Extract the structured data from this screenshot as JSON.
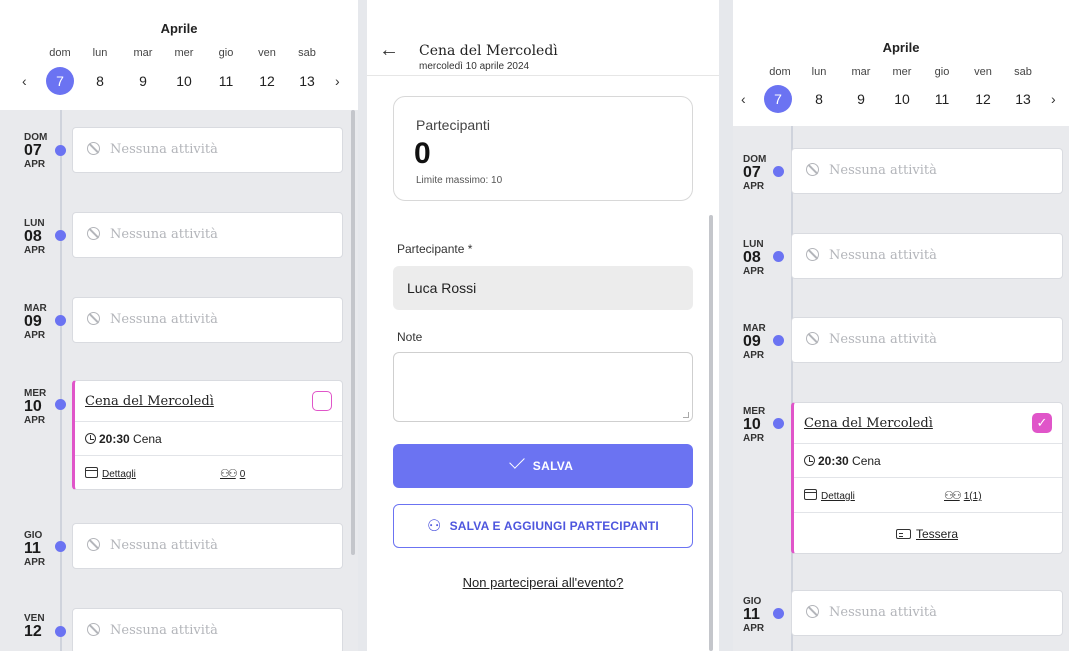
{
  "calendar": {
    "month": "Aprile",
    "weekdays": [
      "dom",
      "lun",
      "mar",
      "mer",
      "gio",
      "ven",
      "sab"
    ],
    "days": [
      "7",
      "8",
      "9",
      "10",
      "11",
      "12",
      "13"
    ],
    "selected_day": "7",
    "prev_glyph": "‹",
    "next_glyph": "›",
    "collapse_glyph": "⌄"
  },
  "timeline": {
    "empty_text": "Nessuna attività",
    "days": [
      {
        "dow": "DOM",
        "num": "07",
        "mon": "APR"
      },
      {
        "dow": "LUN",
        "num": "08",
        "mon": "APR"
      },
      {
        "dow": "MAR",
        "num": "09",
        "mon": "APR"
      },
      {
        "dow": "MER",
        "num": "10",
        "mon": "APR"
      },
      {
        "dow": "GIO",
        "num": "11",
        "mon": "APR"
      },
      {
        "dow": "VEN",
        "num": "12",
        "mon": "APR"
      }
    ]
  },
  "event": {
    "title": "Cena del Mercoledì",
    "time": "20:30",
    "label": "Cena",
    "details": "Dettagli",
    "participants_left": "0",
    "participants_right": "1(1)",
    "card_link": "Tessera",
    "check_glyph": "✓"
  },
  "form": {
    "back_glyph": "←",
    "title": "Cena del Mercoledì",
    "subtitle": "mercoledì 10 aprile 2024",
    "participants_label": "Partecipanti",
    "participants_count": "0",
    "limit_text": "Limite massimo: 10",
    "participant_field_label": "Partecipante *",
    "participant_value": "Luca Rossi",
    "notes_label": "Note",
    "notes_value": "",
    "save_label": "SALVA",
    "save_add_label": "SALVA E AGGIUNGI PARTECIPANTI",
    "not_attending": "Non parteciperai all'evento?",
    "user_add_glyph": "⚇"
  },
  "colors": {
    "accent": "#6b73f2",
    "event_pink": "#e055c9"
  }
}
